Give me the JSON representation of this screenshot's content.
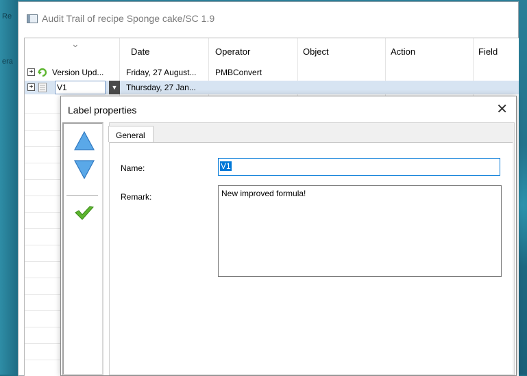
{
  "background": {
    "edge_fragments": [
      "Re",
      "era"
    ]
  },
  "window": {
    "title": "Audit Trail of recipe Sponge cake/SC 1.9"
  },
  "table": {
    "columns": [
      "Date",
      "Operator",
      "Object",
      "Action",
      "Field"
    ],
    "rows": [
      {
        "name": "Version Upd...",
        "date": "Friday, 27 August...",
        "operator": "PMBConvert"
      },
      {
        "name": "V1",
        "date": "Thursday, 27 Jan...",
        "operator": ""
      }
    ]
  },
  "dialog": {
    "title": "Label properties",
    "tab": "General",
    "name_label": "Name:",
    "name_value": "V1",
    "remark_label": "Remark:",
    "remark_value": "New improved formula!"
  },
  "colors": {
    "accent": "#0078d7",
    "up_arrow": "#5aa8e8",
    "down_arrow": "#5aa8e8",
    "check": "#5cb52e"
  },
  "icons": [
    "app-icon",
    "expand-icon",
    "version-update-icon",
    "label-icon",
    "dropdown-icon",
    "close-icon",
    "arrow-up-icon",
    "arrow-down-icon",
    "checkmark-icon"
  ]
}
